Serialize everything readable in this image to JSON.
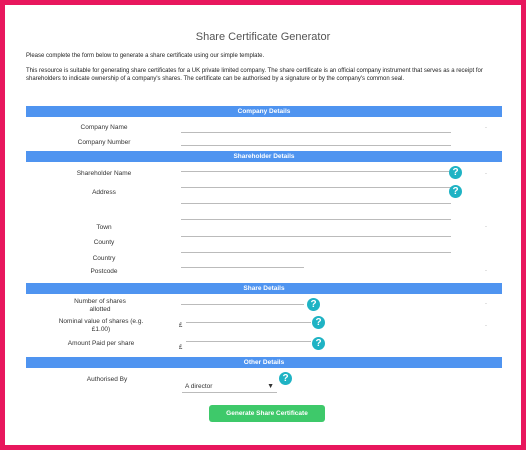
{
  "page": {
    "title": "Share Certificate Generator",
    "intro": "Please complete the form below to generate a share certificate using our simple template.",
    "description": "This resource is suitable for generating share certificates for a UK private limited company. The share certificate is an official company instrument that serves as a receipt for shareholders to indicate ownership of a company's shares. The certificate can be authorised by a signature or by the company's common seal."
  },
  "sections": {
    "company": "Company Details",
    "shareholder": "Shareholder Details",
    "share": "Share Details",
    "other": "Other Details"
  },
  "fields": {
    "company_name": "Company Name",
    "company_number": "Company Number",
    "shareholder_name": "Shareholder Name",
    "address": "Address",
    "town": "Town",
    "county": "County",
    "country": "Country",
    "postcode": "Postcode",
    "shares_allotted": "Number of shares allotted",
    "nominal_value": "Nominal value of shares (e.g. £1.00)",
    "amount_paid": "Amount Paid per share",
    "authorised_by": "Authorised By"
  },
  "currency_symbol": "£",
  "help_glyph": "?",
  "required_marker": "·",
  "authorised_by_value": "A director",
  "dropdown_caret": "▼",
  "submit_label": "Generate Share Certificate",
  "icons": {
    "help": "help-question-icon",
    "caret": "chevron-down-icon"
  },
  "colors": {
    "border": "#e8175d",
    "section_bar": "#4f94f0",
    "help_icon": "#1fb3c4",
    "submit_button": "#3ec96a"
  }
}
